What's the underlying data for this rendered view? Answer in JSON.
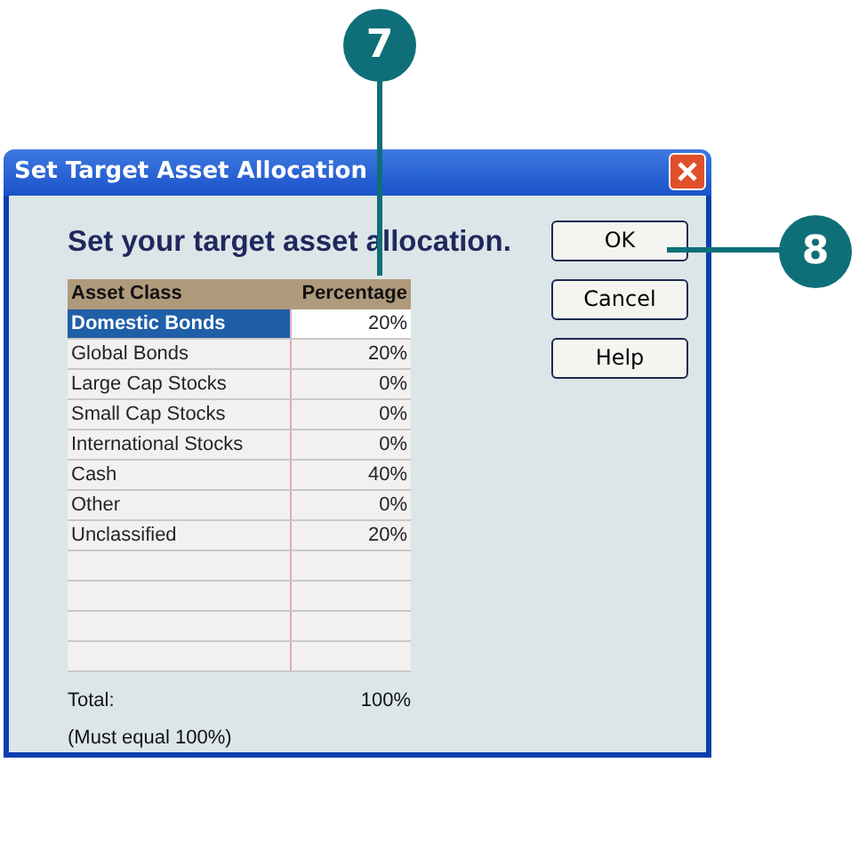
{
  "window": {
    "title": "Set Target Asset Allocation"
  },
  "heading": "Set your target asset allocation.",
  "table": {
    "columns": [
      "Asset Class",
      "Percentage"
    ],
    "rows": [
      {
        "asset_class": "Domestic Bonds",
        "percentage": "20%",
        "selected": true
      },
      {
        "asset_class": "Global Bonds",
        "percentage": "20%",
        "selected": false
      },
      {
        "asset_class": "Large Cap Stocks",
        "percentage": "0%",
        "selected": false
      },
      {
        "asset_class": "Small Cap Stocks",
        "percentage": "0%",
        "selected": false
      },
      {
        "asset_class": "International Stocks",
        "percentage": "0%",
        "selected": false
      },
      {
        "asset_class": "Cash",
        "percentage": "40%",
        "selected": false
      },
      {
        "asset_class": "Other",
        "percentage": "0%",
        "selected": false
      },
      {
        "asset_class": "Unclassified",
        "percentage": "20%",
        "selected": false
      }
    ]
  },
  "total": {
    "label": "Total:",
    "value": "100%",
    "note": "(Must equal 100%)"
  },
  "buttons": [
    "OK",
    "Cancel",
    "Help"
  ],
  "callouts": [
    "7",
    "8"
  ]
}
